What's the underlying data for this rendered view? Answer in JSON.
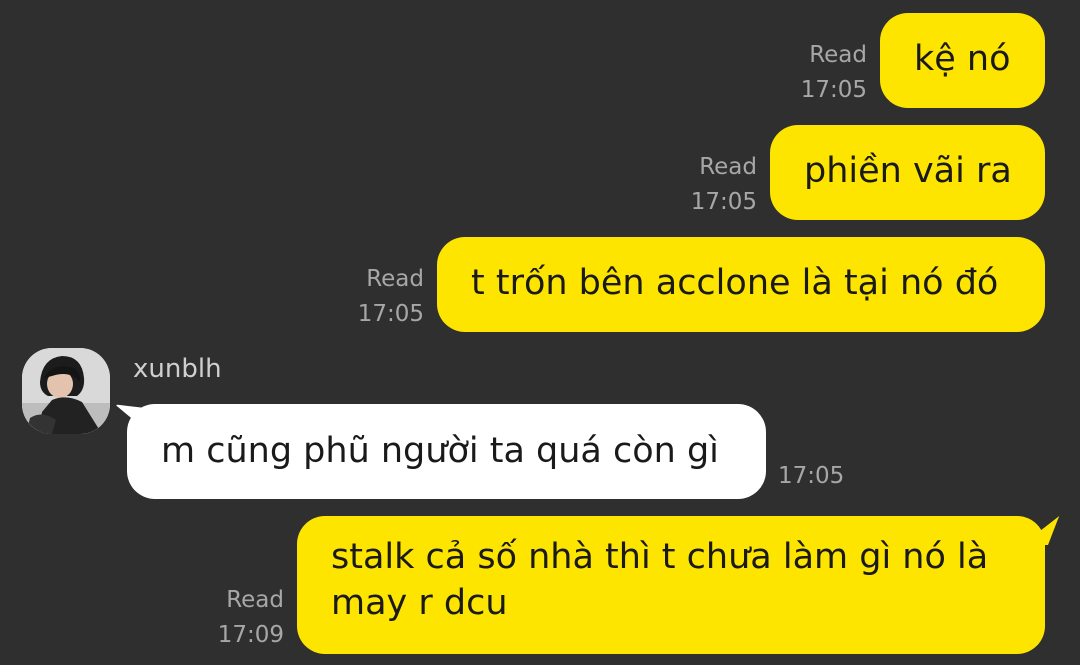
{
  "chat": {
    "messages": [
      {
        "direction": "outgoing",
        "text": "kệ nó",
        "status": "Read",
        "time": "17:05"
      },
      {
        "direction": "outgoing",
        "text": "phiền vãi ra",
        "status": "Read",
        "time": "17:05"
      },
      {
        "direction": "outgoing",
        "text": "t trốn bên acclone là tại nó đó",
        "status": "Read",
        "time": "17:05"
      },
      {
        "direction": "incoming",
        "sender": "xunblh",
        "text": "m cũng phũ người ta quá còn gì",
        "time": "17:05"
      },
      {
        "direction": "outgoing",
        "text_line1": "stalk cả số nhà thì t chưa làm gì nó là",
        "text_line2": "may r dcu",
        "status": "Read",
        "time": "17:09"
      }
    ]
  },
  "colors": {
    "background": "#2f2f30",
    "outgoing_bubble": "#fee500",
    "incoming_bubble": "#ffffff",
    "meta_text": "#a7a7a7"
  }
}
